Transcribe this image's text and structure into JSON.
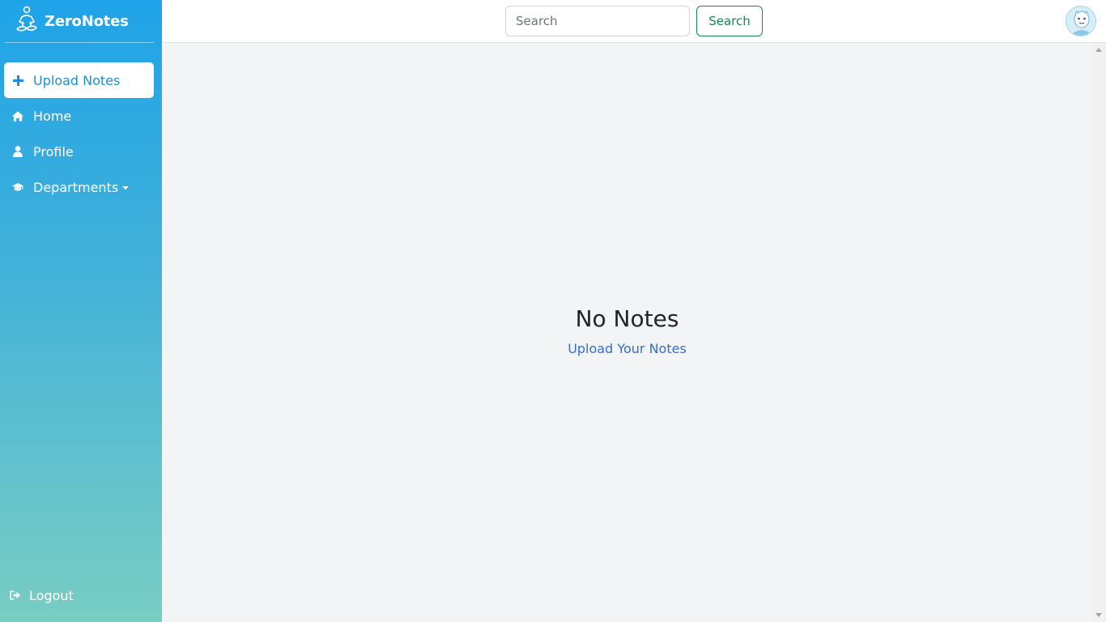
{
  "sidebar": {
    "brand": "ZeroNotes",
    "brand_icon": "meditation-logo-icon",
    "items": [
      {
        "label": "Upload Notes",
        "icon": "plus-icon",
        "active": true
      },
      {
        "label": "Home",
        "icon": "home-icon"
      },
      {
        "label": "Profile",
        "icon": "user-icon"
      },
      {
        "label": "Departments",
        "icon": "graduation-cap-icon",
        "dropdown": true
      }
    ],
    "logout": "Logout",
    "logout_icon": "sign-out-icon"
  },
  "topbar": {
    "search_placeholder": "Search",
    "search_button": "Search",
    "avatar_icon": "avatar-icon"
  },
  "main": {
    "empty_title": "No Notes",
    "empty_link": "Upload Your Notes"
  },
  "colors": {
    "sidebar_top": "#1fa3e8",
    "sidebar_bottom": "#78cdc3",
    "search_button": "#198754",
    "link": "#2f6fe0",
    "background": "#f3f4f6"
  }
}
